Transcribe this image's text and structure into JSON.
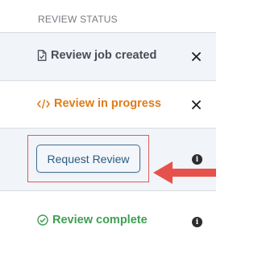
{
  "section": {
    "title": "REVIEW STATUS"
  },
  "rows": [
    {
      "label": "Review job created",
      "icon": "document-check-icon",
      "color": "#4a4e54",
      "action_icon": "close-icon"
    },
    {
      "label": "Review in progress",
      "icon": "code-icon",
      "color": "#e07b16",
      "action_icon": "close-icon"
    },
    {
      "button_label": "Request Review",
      "action_icon": "info-icon",
      "annotation": "red-arrow-pointer"
    },
    {
      "label": "Review complete",
      "icon": "check-circle-icon",
      "color": "#3e9f53",
      "action_icon": "info-icon"
    }
  ],
  "info_glyph": "i",
  "colors": {
    "accent_button_border": "#3f6f93",
    "highlight_red": "#e05a54",
    "row_shade": "#f1f4f8"
  }
}
